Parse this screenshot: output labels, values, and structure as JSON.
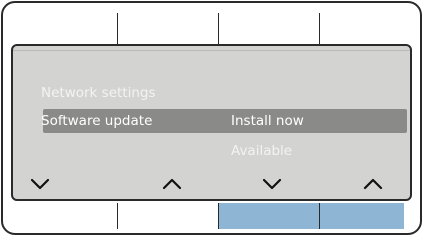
{
  "menu": {
    "item_network": "Network settings",
    "item_update": "Software update",
    "item_update_value": "Install now",
    "item_update_status": "Available"
  },
  "softkeys": [
    {
      "icon": "chevron-down-icon"
    },
    {
      "icon": "chevron-up-icon"
    },
    {
      "icon": "chevron-down-icon"
    },
    {
      "icon": "chevron-up-icon"
    }
  ],
  "colors": {
    "screen_background": "#d3d3d1",
    "selected_row": "#8a8a89",
    "dim_text": "#f3f3f1",
    "highlight_keys": "#8fb5d5",
    "outline": "#2a2a2a"
  }
}
